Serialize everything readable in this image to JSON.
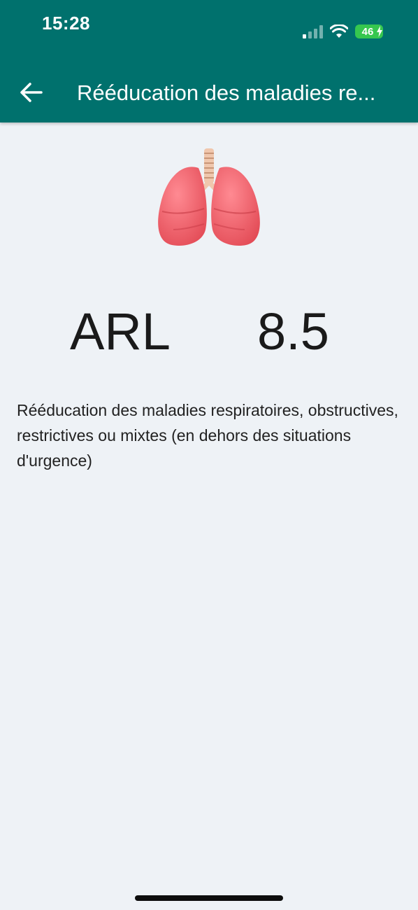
{
  "status_bar": {
    "time": "15:28",
    "battery": "46"
  },
  "header": {
    "title": "Rééducation des maladies re..."
  },
  "act": {
    "code": "ARL",
    "coefficient": "8.5",
    "description": "Rééducation des maladies respiratoires, obstructives, restrictives ou mixtes (en dehors des situations d'urgence)"
  },
  "icons": {
    "back": "arrow-left-icon",
    "illustration": "lungs-icon",
    "signal": "cellular-signal-icon",
    "wifi": "wifi-icon",
    "battery": "battery-charging-icon"
  },
  "colors": {
    "header_bg": "#00716d",
    "page_bg": "#eef2f6",
    "battery": "#36c74f",
    "lungs": "#ef5d67"
  }
}
